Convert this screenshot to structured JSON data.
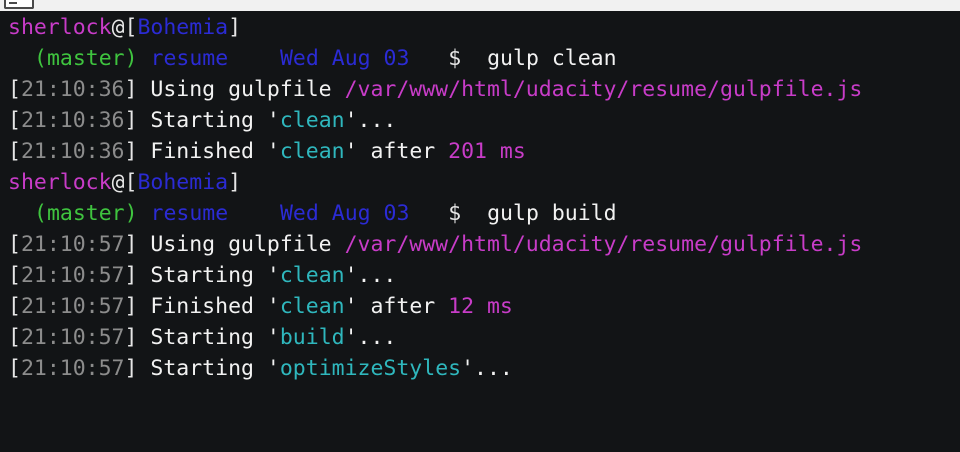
{
  "window": {
    "icon": "terminal-icon"
  },
  "prompts": [
    {
      "user": "sherlock",
      "at": "@",
      "open_bracket": "[",
      "host": "Bohemia",
      "close_bracket": "]",
      "branch": "(master)",
      "dir": "resume",
      "date": "Wed Aug 03",
      "symbol": "$",
      "command": "gulp clean",
      "output": [
        {
          "timestamp": "21:10:36",
          "text": "Using gulpfile ",
          "path": "/var/www/html/udacity/resume/gulpfile.js"
        },
        {
          "timestamp": "21:10:36",
          "text": "Starting '",
          "task": "clean",
          "suffix": "'..."
        },
        {
          "timestamp": "21:10:36",
          "text": "Finished '",
          "task": "clean",
          "suffix": "' after ",
          "duration": "201 ms"
        }
      ]
    },
    {
      "user": "sherlock",
      "at": "@",
      "open_bracket": "[",
      "host": "Bohemia",
      "close_bracket": "]",
      "branch": "(master)",
      "dir": "resume",
      "date": "Wed Aug 03",
      "symbol": "$",
      "command": "gulp build",
      "output": [
        {
          "timestamp": "21:10:57",
          "text": "Using gulpfile ",
          "path": "/var/www/html/udacity/resume/gulpfile.js"
        },
        {
          "timestamp": "21:10:57",
          "text": "Starting '",
          "task": "clean",
          "suffix": "'..."
        },
        {
          "timestamp": "21:10:57",
          "text": "Finished '",
          "task": "clean",
          "suffix": "' after ",
          "duration": "12 ms"
        },
        {
          "timestamp": "21:10:57",
          "text": "Starting '",
          "task": "build",
          "suffix": "'..."
        },
        {
          "timestamp": "21:10:57",
          "text": "Starting '",
          "task": "optimizeStyles",
          "suffix": "'..."
        }
      ]
    }
  ],
  "colors": {
    "background": "#121416",
    "user": "#c83cc8",
    "host": "#2b2bd4",
    "branch": "#3fc43f",
    "task": "#2fb7bd",
    "timestamp": "#8c8c8c"
  }
}
